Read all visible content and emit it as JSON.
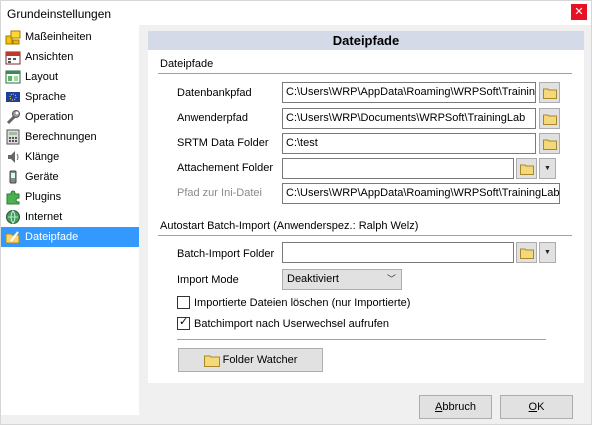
{
  "window": {
    "title": "Grundeinstellungen",
    "close_glyph": "✕"
  },
  "sidebar": {
    "items": [
      {
        "label": "Maßeinheiten",
        "icon": "ruler-icon"
      },
      {
        "label": "Ansichten",
        "icon": "calendar-icon"
      },
      {
        "label": "Layout",
        "icon": "layout-icon"
      },
      {
        "label": "Sprache",
        "icon": "flag-icon"
      },
      {
        "label": "Operation",
        "icon": "wrench-icon"
      },
      {
        "label": "Berechnungen",
        "icon": "calculator-icon"
      },
      {
        "label": "Klänge",
        "icon": "speaker-icon"
      },
      {
        "label": "Geräte",
        "icon": "device-icon"
      },
      {
        "label": "Plugins",
        "icon": "puzzle-icon"
      },
      {
        "label": "Internet",
        "icon": "globe-icon"
      },
      {
        "label": "Dateipfade",
        "icon": "folder-pen-icon",
        "selected": true
      }
    ]
  },
  "panel": {
    "title": "Dateipfade",
    "section1": "Dateipfade",
    "fields": {
      "db_label": "Datenbankpfad",
      "db_value": "C:\\Users\\WRP\\AppData\\Roaming\\WRPSoft\\Training",
      "app_label": "Anwenderpfad",
      "app_value": "C:\\Users\\WRP\\Documents\\WRPSoft\\TrainingLab",
      "srtm_label": "SRTM Data Folder",
      "srtm_value": "C:\\test",
      "attach_label": "Attachement Folder",
      "attach_value": "",
      "ini_label": "Pfad zur Ini-Datei",
      "ini_value": "C:\\Users\\WRP\\AppData\\Roaming\\WRPSoft\\TrainingLab\\T"
    },
    "section2": "Autostart Batch-Import  (Anwenderspez.: Ralph Welz)",
    "batch_folder_label": "Batch-Import Folder",
    "batch_folder_value": "",
    "import_mode_label": "Import Mode",
    "import_mode_value": "Deaktiviert",
    "checkbox_delete_label": "Importierte Dateien löschen (nur Importierte)",
    "checkbox_delete_checked": false,
    "checkbox_batch_label": "Batchimport nach Userwechsel aufrufen",
    "checkbox_batch_checked": true,
    "folder_watcher_label": "Folder Watcher"
  },
  "footer": {
    "cancel_label": "Abbruch",
    "cancel_underline": "A",
    "cancel_rest": "bbruch",
    "ok_label": "OK",
    "ok_underline": "O",
    "ok_rest": "K"
  },
  "colors": {
    "selected_bg": "#3399ff",
    "header_bg": "#d5dae8",
    "close_bg": "#e81123"
  }
}
